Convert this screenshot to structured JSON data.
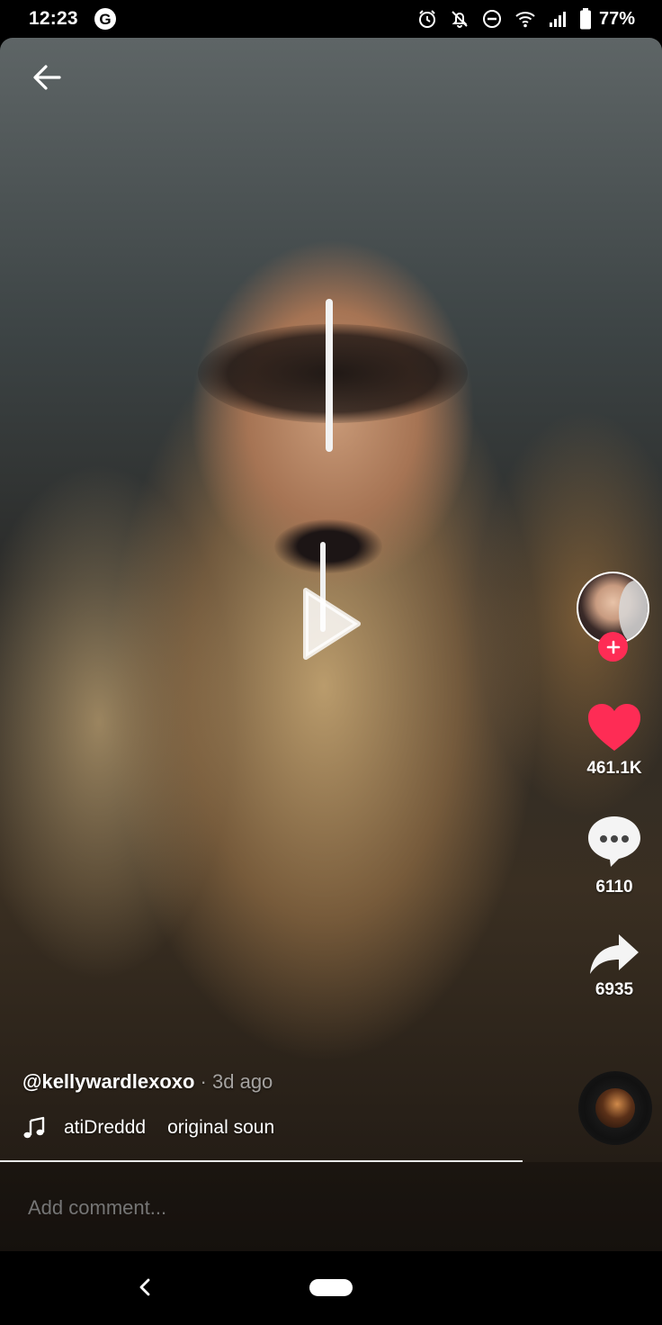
{
  "status_bar": {
    "time": "12:23",
    "battery_percent": "77%",
    "icons": [
      "google-icon",
      "alarm-icon",
      "notifications-off-icon",
      "do-not-disturb-icon",
      "wifi-icon",
      "cell-signal-icon",
      "battery-icon"
    ]
  },
  "video": {
    "state": "paused",
    "play_icon": "play-icon",
    "progress_fraction": 0.79
  },
  "side_actions": {
    "avatar_icon": "creator-avatar",
    "follow_icon": "plus-icon",
    "like_count": "461.1K",
    "comment_count": "6110",
    "share_count": "6935",
    "colors": {
      "like": "#fe2c55",
      "follow": "#fe2c55"
    }
  },
  "caption": {
    "username": "@kellywardlexoxo",
    "separator": " · ",
    "posted": "3d ago"
  },
  "music": {
    "artist": "atiDreddd",
    "title": "original soun"
  },
  "comment": {
    "placeholder": "Add comment..."
  }
}
